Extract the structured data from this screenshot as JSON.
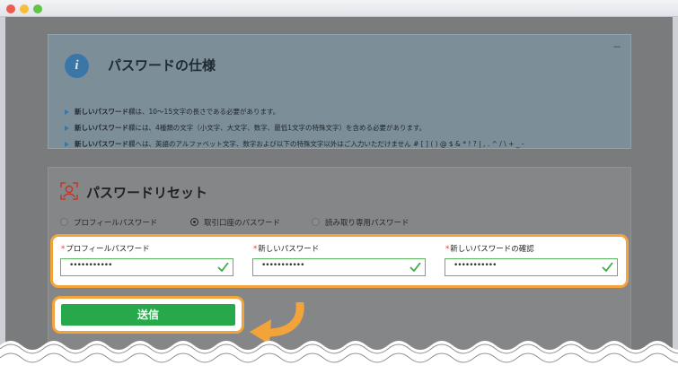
{
  "info": {
    "title": "パスワードの仕様",
    "collapse_symbol": "−",
    "bullets": [
      {
        "strong": "新しいパスワード",
        "rest": "欄は、10～15文字の長さである必要があります。"
      },
      {
        "strong": "新しいパスワード",
        "rest": "欄には、4種類の文字（小文字、大文字、数字、最低1文字の特殊文字）を含める必要があります。"
      },
      {
        "strong": "新しいパスワード",
        "rest": "欄へは、英語のアルファベット文字、数字および以下の特殊文字以外はご入力いただけません # [ ] ( ) @ $ & * ! ? | , . ^ / \\ + _ -"
      }
    ]
  },
  "reset": {
    "title": "パスワードリセット",
    "radios": [
      {
        "label": "プロフィールパスワード",
        "selected": false
      },
      {
        "label": "取引口座のパスワード",
        "selected": true
      },
      {
        "label": "読み取り専用パスワード",
        "selected": false
      }
    ],
    "fields": [
      {
        "required_mark": "*",
        "label": "プロフィールパスワード",
        "value": "•••••••••••",
        "valid": true
      },
      {
        "required_mark": "*",
        "label": "新しいパスワード",
        "value": "•••••••••••",
        "valid": true
      },
      {
        "required_mark": "*",
        "label": "新しいパスワードの確認",
        "value": "•••••••••••",
        "valid": true
      }
    ],
    "submit_label": "送信"
  },
  "colors": {
    "highlight": "#f2a33a",
    "submit": "#27a84a",
    "info_icon": "#3a77a6",
    "valid_check": "#3cab4b"
  },
  "icons": [
    "info-icon",
    "reset-person-icon",
    "check-icon",
    "curved-arrow-icon"
  ]
}
